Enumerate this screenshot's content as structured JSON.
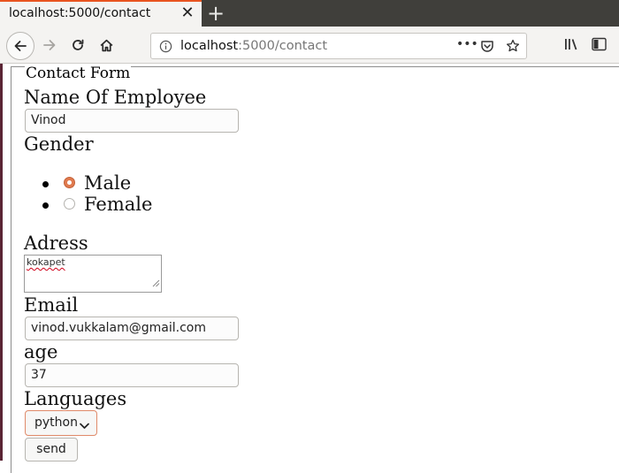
{
  "browser": {
    "tab_title": "localhost:5000/contact",
    "tab_close": "✕",
    "new_tab": "+",
    "url_host": "localhost",
    "url_rest": ":5000/contact",
    "url_more": "•••"
  },
  "form": {
    "legend": "Contact Form",
    "name_label": "Name Of Employee",
    "name_value": "Vinod",
    "gender_label": "Gender",
    "gender_options": [
      "Male",
      "Female"
    ],
    "gender_selected": "Male",
    "address_label": "Adress",
    "address_value": "kokapet",
    "email_label": "Email",
    "email_value": "vinod.vukkalam@gmail.com",
    "age_label": "age",
    "age_value": "37",
    "languages_label": "Languages",
    "language_selected": "python",
    "send_label": "send"
  },
  "colors": {
    "accent": "#e95420",
    "tabbar": "#403f3b",
    "radio_checked": "#e07a4e"
  }
}
